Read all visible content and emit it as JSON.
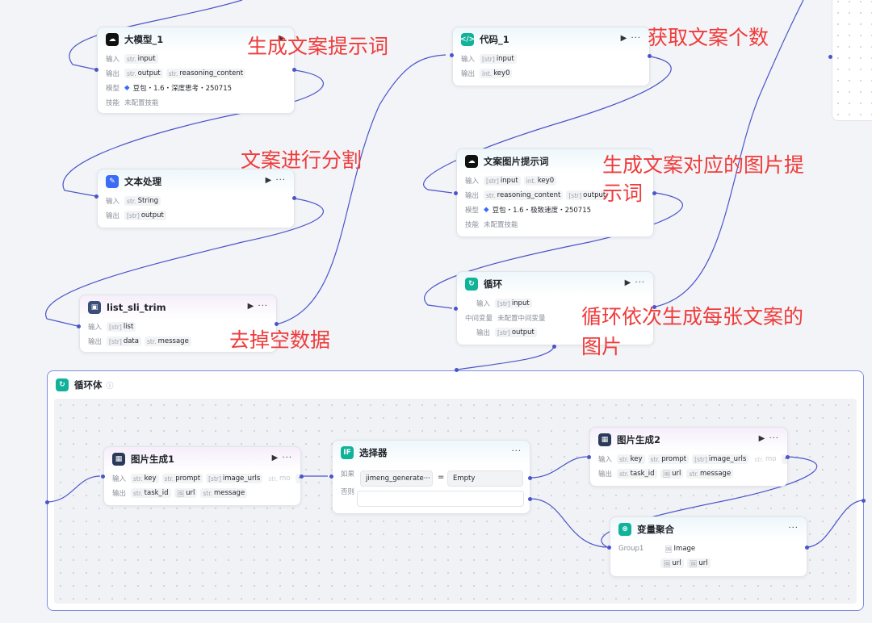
{
  "canvas": {
    "accent_color": "#4a55c9",
    "annotation_color": "#ef3b3b"
  },
  "annotations": {
    "gen_prompt": "生成文案提示词",
    "split": "文案进行分割",
    "remove_empty": "去掉空数据",
    "get_count": "获取文案个数",
    "image_prompt_line1": "生成文案对应的图片提",
    "image_prompt_line2": "示词",
    "loop_line1": "循环依次生成每张文案的",
    "loop_line2": "图片"
  },
  "common": {
    "input": "输入",
    "output": "输出",
    "model": "模型",
    "skill": "技能",
    "no_skill": "未配置技能",
    "more": "···",
    "run": "▶"
  },
  "types": {
    "str": "str.",
    "arr": "[str]",
    "int": "int.",
    "img": "🖼"
  },
  "nodes": {
    "llm1": {
      "title": "大模型_1",
      "inputs": [
        "input"
      ],
      "outputs": [
        "output",
        "reasoning_content"
      ],
      "model": "豆包・1.6・深度思考・250715"
    },
    "text": {
      "title": "文本处理",
      "inputs": [
        "String"
      ],
      "outputs": [
        "output"
      ]
    },
    "trim": {
      "title": "list_sli_trim",
      "inputs": [
        "list"
      ],
      "outputs": [
        "data",
        "message"
      ]
    },
    "code": {
      "title": "代码_1",
      "inputs": [
        "input"
      ],
      "outputs": [
        "key0"
      ]
    },
    "imgprompt": {
      "title": "文案图片提示词",
      "inputs": [
        "input",
        "key0"
      ],
      "outputs": [
        "reasoning_content",
        "output"
      ],
      "model": "豆包・1.6・极致速度・250715"
    },
    "loop": {
      "title": "循环",
      "input_label": "输入",
      "inputs": [
        "input"
      ],
      "mid_label": "中间变量",
      "mid_value": "未配置中间变量",
      "output_label": "输出",
      "outputs": [
        "output"
      ]
    },
    "loopbody": {
      "title": "循环体",
      "info_icon": "ⓘ"
    },
    "imggen1": {
      "title": "图片生成1",
      "inputs": [
        "key",
        "prompt",
        "image_urls",
        "mo"
      ],
      "outputs": [
        "task_id",
        "url",
        "message"
      ]
    },
    "selector": {
      "title": "选择器",
      "if_label": "如果",
      "else_label": "否则",
      "cond_var": "jimeng_generate···",
      "cond_op": "=",
      "cond_val": "Empty"
    },
    "imggen2": {
      "title": "图片生成2",
      "inputs": [
        "key",
        "prompt",
        "image_urls",
        "mo"
      ],
      "outputs": [
        "task_id",
        "url",
        "message"
      ]
    },
    "agg": {
      "title": "变量聚合",
      "group": "Group1",
      "group_name": "Image",
      "items": [
        "url",
        "url"
      ]
    }
  }
}
